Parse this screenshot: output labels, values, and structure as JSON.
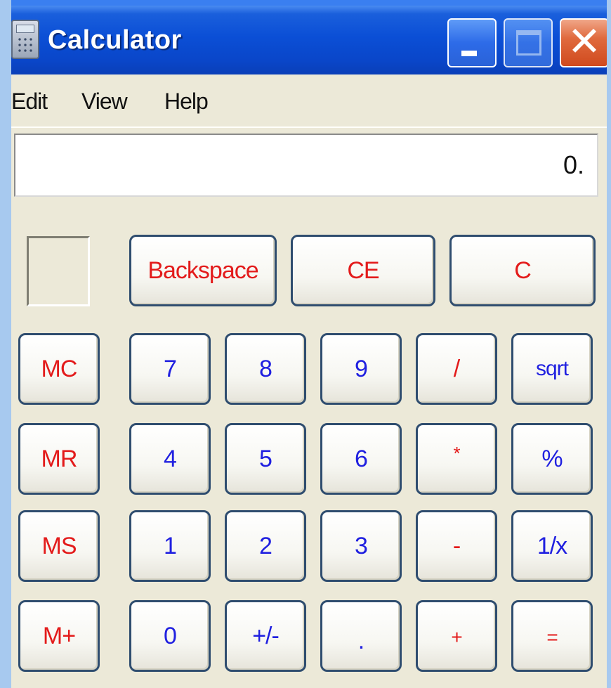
{
  "window": {
    "title": "Calculator",
    "close_glyph": "✕"
  },
  "menu": {
    "items": [
      "Edit",
      "View",
      "Help"
    ]
  },
  "display": {
    "value": "0."
  },
  "keys": {
    "backspace": "Backspace",
    "ce": "CE",
    "c": "C",
    "mc": "MC",
    "mr": "MR",
    "ms": "MS",
    "mplus": "M+",
    "d7": "7",
    "d8": "8",
    "d9": "9",
    "div": "/",
    "sqrt": "sqrt",
    "d4": "4",
    "d5": "5",
    "d6": "6",
    "mul": "*",
    "pct": "%",
    "d1": "1",
    "d2": "2",
    "d3": "3",
    "sub": "-",
    "recip": "1/x",
    "d0": "0",
    "sign": "+/-",
    "dot": ".",
    "add": "+",
    "eq": "="
  },
  "colors": {
    "titlebar": "#0b4fd6",
    "window_bg": "#ece9d8",
    "operator_text": "#e31b1b",
    "digit_text": "#2020e0",
    "close_button": "#d04a1e"
  },
  "icons": {
    "app": "calculator-icon",
    "minimize": "minimize-icon",
    "maximize": "maximize-icon",
    "close": "close-icon"
  }
}
